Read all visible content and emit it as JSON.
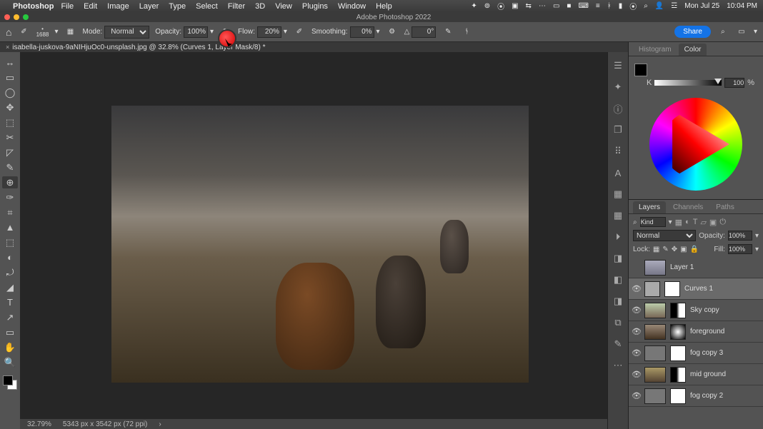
{
  "menubar": {
    "app": "Photoshop",
    "items": [
      "File",
      "Edit",
      "Image",
      "Layer",
      "Type",
      "Select",
      "Filter",
      "3D",
      "View",
      "Plugins",
      "Window",
      "Help"
    ],
    "right": {
      "day": "Mon Jul 25",
      "time": "10:04 PM"
    }
  },
  "titlebar": {
    "title": "Adobe Photoshop 2022"
  },
  "optbar": {
    "brush_size": "1688",
    "mode_label": "Mode:",
    "mode_value": "Normal",
    "opacity_label": "Opacity:",
    "opacity_value": "100%",
    "flow_label": "Flow:",
    "flow_value": "20%",
    "smoothing_label": "Smoothing:",
    "smoothing_value": "0%",
    "angle_value": "0°",
    "share": "Share"
  },
  "doctab": {
    "close": "×",
    "label": "isabella-juskova-9aNIHjuOc0-unsplash.jpg @ 32.8% (Curves 1, Layer Mask/8) *"
  },
  "status": {
    "zoom": "32.79%",
    "dims": "5343 px x 3542 px (72 ppi)"
  },
  "colorpanel": {
    "tabs": [
      "Histogram",
      "Color"
    ],
    "k_label": "K",
    "k_value": "100",
    "k_pct": "%"
  },
  "layerspanel": {
    "tabs": [
      "Layers",
      "Channels",
      "Paths"
    ],
    "filter_kind": "Kind",
    "blend_mode": "Normal",
    "opacity_label": "Opacity:",
    "opacity_value": "100%",
    "lock_label": "Lock:",
    "fill_label": "Fill:",
    "fill_value": "100%",
    "layers": [
      {
        "name": "Layer 1",
        "eye": ""
      },
      {
        "name": "Curves 1",
        "eye": "👁",
        "selected": true
      },
      {
        "name": "Sky copy",
        "eye": "👁"
      },
      {
        "name": "foreground",
        "eye": "👁"
      },
      {
        "name": "fog copy 3",
        "eye": "👁"
      },
      {
        "name": "mid ground",
        "eye": "👁"
      },
      {
        "name": "fog copy 2",
        "eye": "👁"
      }
    ]
  },
  "tools": [
    "↔",
    "▭",
    "◯",
    "✥",
    "⬚",
    "✂",
    "◸",
    "✎",
    "⊕",
    "✑",
    "⌗",
    "▲",
    "⬚",
    "◐",
    "⤾",
    "◢",
    "T",
    "↗",
    "▭",
    "✋",
    "🔍"
  ],
  "dock_icons": [
    "☰",
    "✦",
    "ⓘ",
    "❐",
    "⠿",
    "A",
    "▦",
    "▦",
    "⏵",
    "◨",
    "◧",
    "◨",
    "⧉",
    "✎",
    "⋯"
  ]
}
